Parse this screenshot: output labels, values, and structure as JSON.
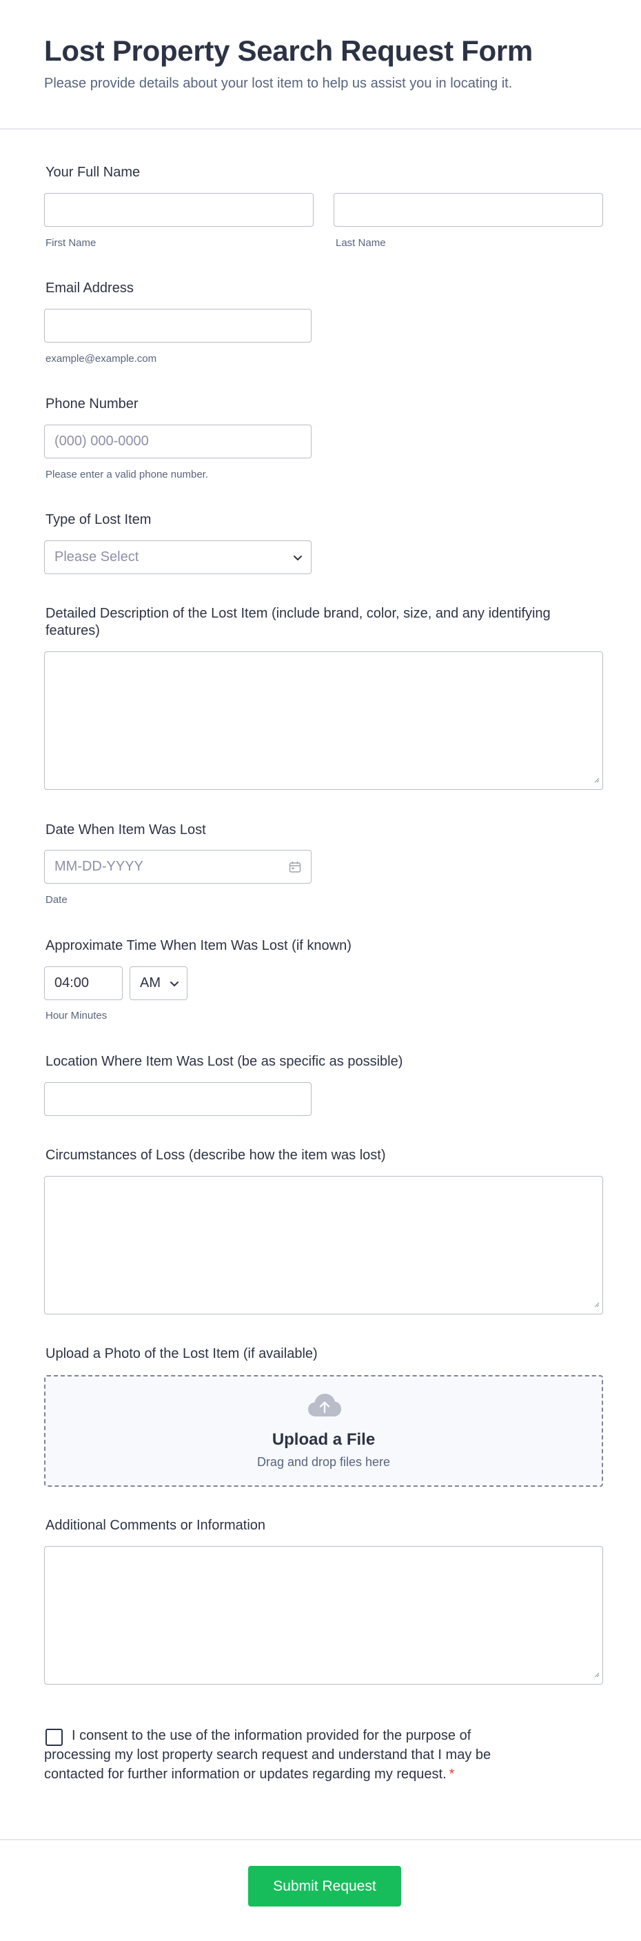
{
  "header": {
    "title": "Lost Property Search Request Form",
    "subtitle": "Please provide details about your lost item to help us assist you in locating it."
  },
  "full_name": {
    "label": "Your Full Name",
    "first_sublabel": "First Name",
    "last_sublabel": "Last Name",
    "first_value": "",
    "last_value": ""
  },
  "email": {
    "label": "Email Address",
    "value": "",
    "sublabel": "example@example.com"
  },
  "phone": {
    "label": "Phone Number",
    "placeholder": "(000) 000-0000",
    "sublabel": "Please enter a valid phone number."
  },
  "item_type": {
    "label": "Type of Lost Item",
    "selected": "Please Select"
  },
  "description": {
    "label": "Detailed Description of the Lost Item (include brand, color, size, and any identifying features)"
  },
  "date_lost": {
    "label": "Date When Item Was Lost",
    "placeholder": "MM-DD-YYYY",
    "sublabel": "Date"
  },
  "time_lost": {
    "label": "Approximate Time When Item Was Lost (if known)",
    "time_value": "04:00",
    "ampm": "AM",
    "sublabel": "Hour Minutes"
  },
  "location": {
    "label": "Location Where Item Was Lost (be as specific as possible)",
    "value": ""
  },
  "circumstances": {
    "label": "Circumstances of Loss (describe how the item was lost)"
  },
  "upload": {
    "label": "Upload a Photo of the Lost Item (if available)",
    "title": "Upload a File",
    "subtitle": "Drag and drop files here",
    "icon": "cloud-upload-icon"
  },
  "comments": {
    "label": "Additional Comments or Information"
  },
  "consent": {
    "text": "I consent to the use of the information provided for the purpose of processing my lost property search request and understand that I may be contacted for further information or updates regarding my request.",
    "required_mark": "*",
    "checked": false
  },
  "submit": {
    "label": "Submit Request"
  },
  "colors": {
    "accent": "#18bd5b",
    "text": "#2c3345",
    "muted": "#57647e",
    "border": "#b8bdc9",
    "required": "#f23a3c"
  }
}
